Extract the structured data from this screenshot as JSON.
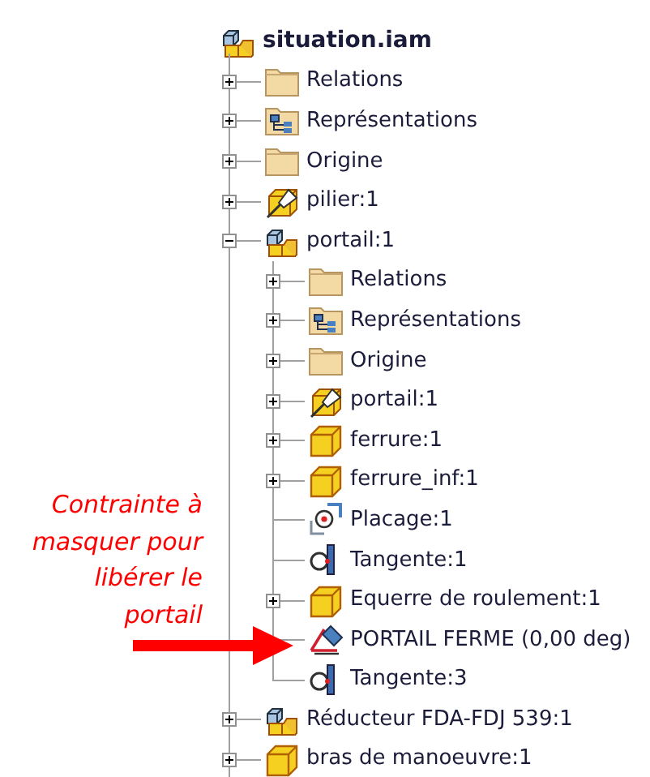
{
  "tree": {
    "label": "situation.iam",
    "kind": "assembly",
    "children": [
      {
        "label": "Relations",
        "kind": "folder",
        "expanded": false
      },
      {
        "label": "Représentations",
        "kind": "representations",
        "expanded": false
      },
      {
        "label": "Origine",
        "kind": "folder",
        "expanded": false
      },
      {
        "label": "pilier:1",
        "kind": "grounded",
        "expanded": false
      },
      {
        "label": "portail:1",
        "kind": "assembly",
        "expanded": true,
        "children": [
          {
            "label": "Relations",
            "kind": "folder",
            "expanded": false
          },
          {
            "label": "Représentations",
            "kind": "representations",
            "expanded": false
          },
          {
            "label": "Origine",
            "kind": "folder",
            "expanded": false
          },
          {
            "label": "portail:1",
            "kind": "grounded",
            "expanded": false
          },
          {
            "label": "ferrure:1",
            "kind": "part",
            "expanded": false
          },
          {
            "label": "ferrure_inf:1",
            "kind": "part",
            "expanded": false
          },
          {
            "label": "Placage:1",
            "kind": "mate"
          },
          {
            "label": "Tangente:1",
            "kind": "tangent"
          },
          {
            "label": "Equerre de roulement:1",
            "kind": "part",
            "expanded": false
          },
          {
            "label": "PORTAIL FERME (0,00 deg)",
            "kind": "angle"
          },
          {
            "label": "Tangente:3",
            "kind": "tangent"
          }
        ]
      },
      {
        "label": "Réducteur FDA-FDJ 539:1",
        "kind": "assembly",
        "expanded": false
      },
      {
        "label": "bras de manoeuvre:1",
        "kind": "part",
        "expanded": false
      }
    ]
  },
  "annotation": {
    "lines": [
      "Contrainte à",
      "masquer pour",
      "libérer le",
      "portail"
    ]
  }
}
